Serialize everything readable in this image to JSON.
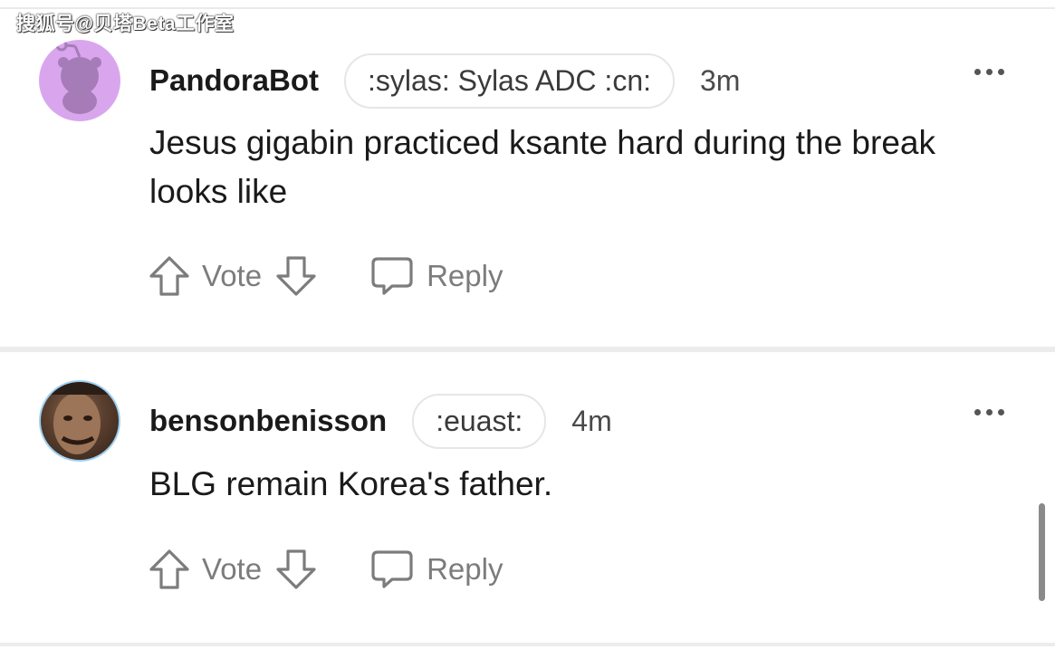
{
  "watermark": "搜狐号@贝塔Beta工作室",
  "comments": [
    {
      "username": "PandoraBot",
      "flair": ":sylas: Sylas ADC :cn:",
      "time": "3m",
      "body": "Jesus gigabin practiced ksante hard during the break looks like",
      "vote_label": "Vote",
      "reply_label": "Reply",
      "avatar_icon": "snoo-avatar-icon"
    },
    {
      "username": "bensonbenisson",
      "flair": ":euast:",
      "time": "4m",
      "body": "BLG remain Korea's father.",
      "vote_label": "Vote",
      "reply_label": "Reply",
      "avatar_icon": "user-photo-avatar"
    }
  ],
  "colors": {
    "text": "#1a1a1b",
    "muted": "#7c7c7e",
    "bot_avatar_bg": "#d9a6ee",
    "divider": "#ececec"
  }
}
